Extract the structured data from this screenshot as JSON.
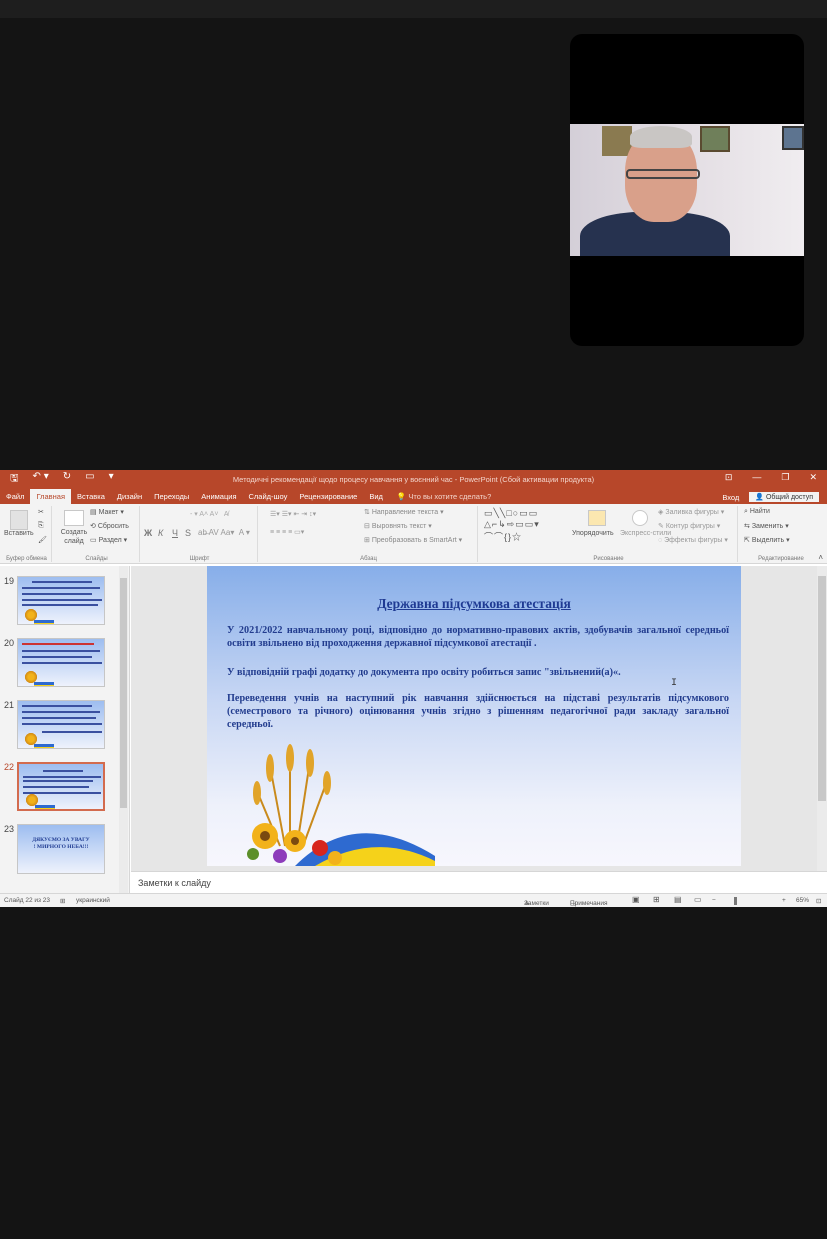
{
  "window": {
    "doc_title": "Методичні рекомендації щодо процесу навчання у воєнний час - PowerPoint (Сбой активации продукта)",
    "quick_access": [
      "save-icon",
      "undo-icon",
      "redo-icon",
      "present-icon"
    ]
  },
  "menu": {
    "tabs": [
      "Файл",
      "Главная",
      "Вставка",
      "Дизайн",
      "Переходы",
      "Анимация",
      "Слайд-шоу",
      "Рецензирование",
      "Вид"
    ],
    "active_tab": "Главная",
    "tell_me": "Что вы хотите сделать?",
    "signin": "Вход",
    "share": "Общий доступ"
  },
  "ribbon": {
    "clipboard": {
      "paste": "Вставить",
      "label": "Буфер обмена"
    },
    "slides": {
      "new_slide": "Создать слайд",
      "layout": "Макет",
      "reset": "Сбросить",
      "section": "Раздел",
      "label": "Слайды"
    },
    "font": {
      "label": "Шрифт",
      "bold": "Ж",
      "italic": "К",
      "underline": "Ч",
      "shadow": "S"
    },
    "paragraph": {
      "text_direction": "Направление текста",
      "align_text": "Выровнять текст",
      "smartart": "Преобразовать в SmartArt",
      "label": "Абзац"
    },
    "drawing": {
      "arrange": "Упорядочить",
      "quick_styles": "Экспресс-стили",
      "fill": "Заливка фигуры",
      "outline": "Контур фигуры",
      "effects": "Эффекты фигуры",
      "label": "Рисование"
    },
    "editing": {
      "find": "Найти",
      "replace": "Заменить",
      "select": "Выделить",
      "label": "Редактирование"
    }
  },
  "thumbnails": [
    {
      "num": "19",
      "kind": "text"
    },
    {
      "num": "20",
      "kind": "text"
    },
    {
      "num": "21",
      "kind": "text"
    },
    {
      "num": "22",
      "kind": "title",
      "active": true
    },
    {
      "num": "23",
      "kind": "thanks",
      "text": "ДЯКУЄМО ЗА УВАГУ ! МИРНОГО НЕБА!!!"
    }
  ],
  "slide": {
    "title": "Державна підсумкова атестація",
    "p1": "У 2021/2022 навчальному році, відповідно до нормативно-правових актів, здобувачів загальної середньої освіти звільнено від проходження державної підсумкової атестації .",
    "p2": "У відповідній графі додатку до документа про освіту робиться запис \"звільнений(а)«.",
    "p3": "Переведення учнів на наступний рік навчання здійснюється на підставі результатів підсумкового (семестрового та річного) оцінювання учнів згідно з рішенням педагогічної ради закладу загальної середньої."
  },
  "notes": {
    "placeholder": "Заметки к слайду"
  },
  "status": {
    "slide_info": "Слайд 22 из 23",
    "language": "украинский",
    "notes_btn": "Заметки",
    "comments_btn": "Примечания",
    "zoom": "65%"
  },
  "colors": {
    "accent": "#b7472a",
    "slide_text": "#223c8e"
  }
}
